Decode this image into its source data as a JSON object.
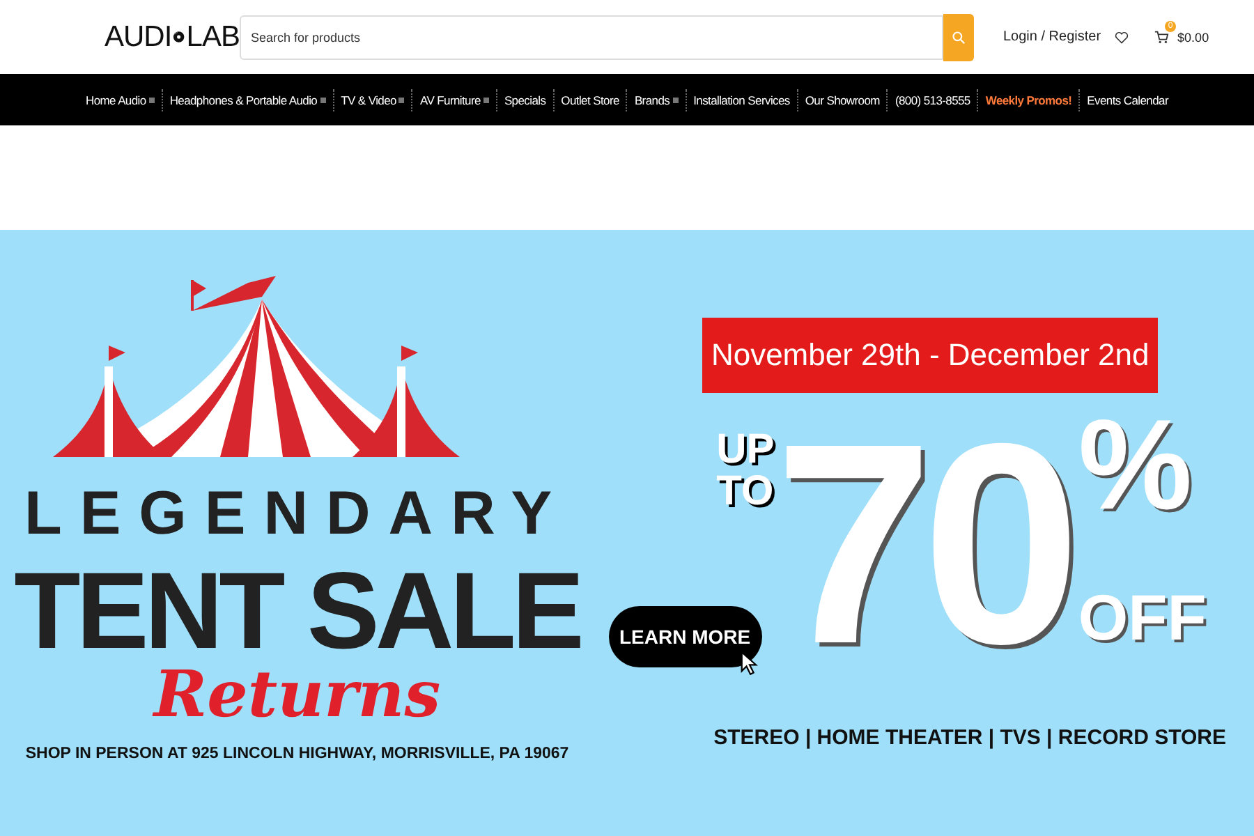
{
  "header": {
    "logo": {
      "left": "AUDI",
      "right": "LAB"
    },
    "search": {
      "placeholder": "Search for products"
    },
    "login": "Login / Register",
    "cart": {
      "count": "0",
      "total": "$0.00"
    }
  },
  "nav": [
    {
      "label": "Home Audio",
      "has_dropdown": true,
      "kind": "link"
    },
    {
      "label": "Headphones & Portable Audio",
      "has_dropdown": true,
      "kind": "link"
    },
    {
      "label": "TV & Video",
      "has_dropdown": true,
      "kind": "link"
    },
    {
      "label": "AV Furniture",
      "has_dropdown": true,
      "kind": "link"
    },
    {
      "label": "Specials",
      "has_dropdown": false,
      "kind": "link"
    },
    {
      "label": "Outlet Store",
      "has_dropdown": false,
      "kind": "link"
    },
    {
      "label": "Brands",
      "has_dropdown": true,
      "kind": "link"
    },
    {
      "label": "Installation Services",
      "has_dropdown": false,
      "kind": "link"
    },
    {
      "label": "Our Showroom",
      "has_dropdown": false,
      "kind": "link"
    },
    {
      "label": "(800) 513-8555",
      "has_dropdown": false,
      "kind": "link"
    },
    {
      "label": "Weekly Promos!",
      "has_dropdown": false,
      "kind": "promo"
    },
    {
      "label": "Events Calendar",
      "has_dropdown": false,
      "kind": "link"
    }
  ],
  "banner": {
    "headline": "LEGENDARY",
    "title": "TENT SALE",
    "script": "Returns",
    "address": "SHOP IN PERSON AT 925 LINCOLN HIGHWAY, MORRISVILLE, PA 19067",
    "button": "LEARN MORE",
    "dates": "November 29th - December 2nd",
    "up": "UP",
    "to": "TO",
    "discount": "70",
    "percent": "%",
    "off": "OFF",
    "categories": "STEREO | HOME THEATER | TVS | RECORD STORE"
  }
}
